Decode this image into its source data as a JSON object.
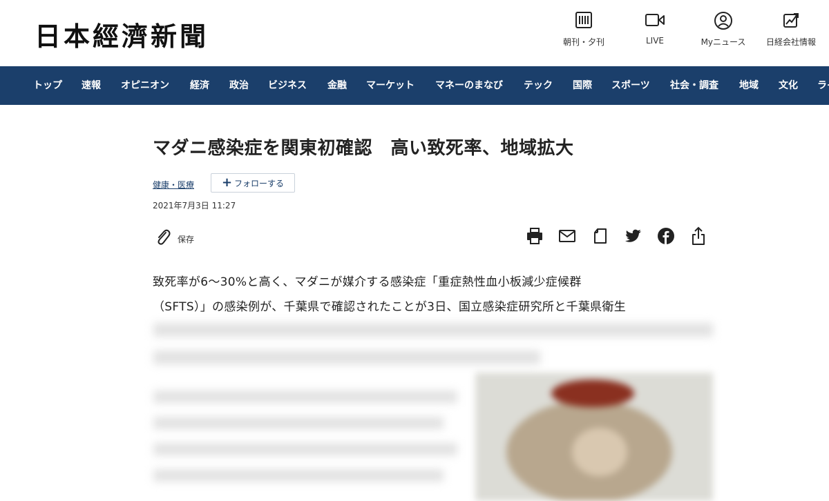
{
  "header": {
    "logo": "日本經濟新聞",
    "actions": [
      {
        "label": "朝刊・夕刊",
        "icon": "newspaper-icon"
      },
      {
        "label": "LIVE",
        "icon": "video-camera-icon"
      },
      {
        "label": "Myニュース",
        "icon": "user-circle-icon"
      },
      {
        "label": "日経会社情報",
        "icon": "chart-icon"
      }
    ]
  },
  "nav": {
    "items": [
      "トップ",
      "速報",
      "オピニオン",
      "経済",
      "政治",
      "ビジネス",
      "金融",
      "マーケット",
      "マネーのまなび",
      "テック",
      "国際",
      "スポーツ",
      "社会・調査",
      "地域",
      "文化",
      "ライフ"
    ]
  },
  "article": {
    "title": "マダニ感染症を関東初確認　高い致死率、地域拡大",
    "topic": "健康・医療",
    "follow_label": "フォローする",
    "date": "2021年7月3日 11:27",
    "save_label": "保存",
    "share_icons": [
      "print-icon",
      "mail-icon",
      "note-icon",
      "twitter-icon",
      "facebook-icon",
      "share-icon"
    ],
    "body_lines": [
      "致死率が6〜30%と高く、マダニが媒介する感染症「重症熱性血小板減少症候群",
      "（SFTS）」の感染例が、千葉県で確認されたことが3日、国立感染症研究所と千葉県衛生"
    ]
  },
  "colors": {
    "nav_bg": "#1b3f6b",
    "link": "#1b3f6b"
  }
}
